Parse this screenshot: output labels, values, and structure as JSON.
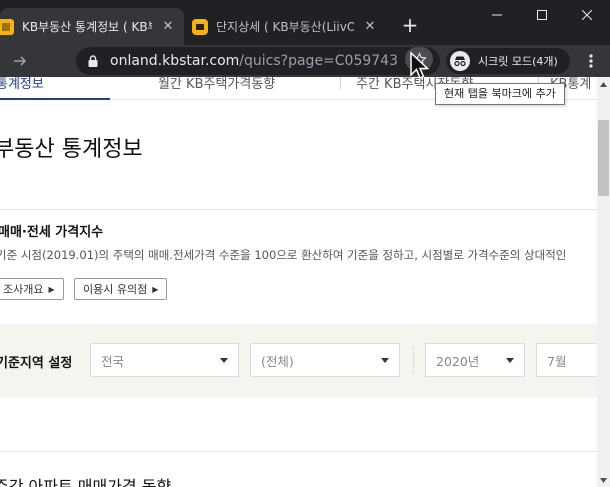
{
  "browser": {
    "tabs": [
      {
        "title": "KB부동산 통계정보 ( KB부",
        "active": true
      },
      {
        "title": "단지상세 ( KB부동산(LiivON",
        "active": false
      }
    ],
    "new_tab_label": "+",
    "url_host": "onland.kbstar.com",
    "url_path": "/quics?page=C059743",
    "profile_label": "시크릿 모드(4개)",
    "bookmark_tooltip": "현재 탭을 북마크에 추가"
  },
  "subnav": {
    "items": [
      "통계정보",
      "월간 KB주택가격동향",
      "주간 KB주택시장동향",
      "KB통계"
    ]
  },
  "page": {
    "title": "부동산 통계정보",
    "section": {
      "title": "매매·전세 가격지수",
      "description": "기준 시점(2019.01)의 주택의 매매.전세가격 수준을 100으로 환산하여 기준을 정하고, 시점별로 가격수준의 상대적인",
      "buttons": [
        "조사개요",
        "이용시 유의점"
      ]
    },
    "region": {
      "label": "기준지역 설정",
      "selects": [
        "전국",
        "(전체)",
        "2020년",
        "7월"
      ]
    },
    "bottom_title": "주간 아파트 매매가격 동향"
  },
  "colors": {
    "chrome_dark": "#202124",
    "chrome_toolbar": "#35363a",
    "brand_blue": "#1d3d8f",
    "favicon_yellow": "#f6b20f",
    "region_bg": "#f6f4ef"
  }
}
